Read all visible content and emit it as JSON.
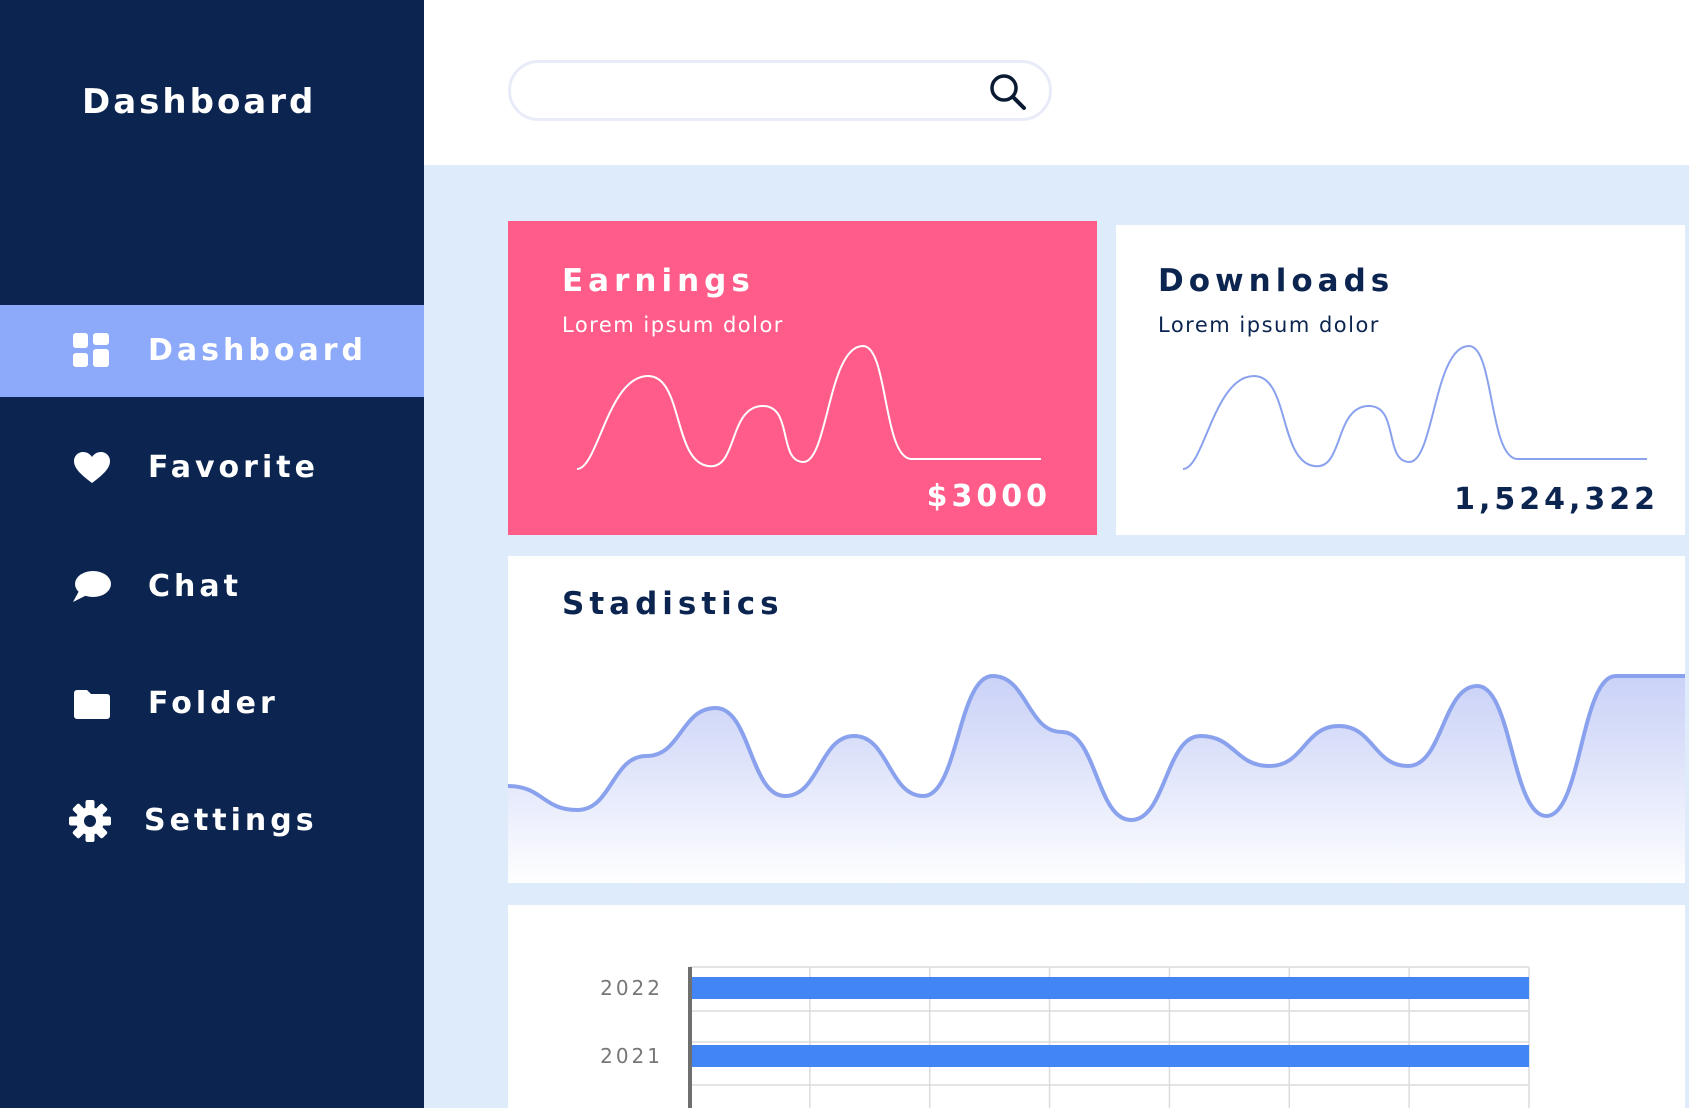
{
  "sidebar": {
    "title": "Dashboard",
    "items": [
      {
        "label": "Dashboard",
        "icon": "grid-icon",
        "active": true
      },
      {
        "label": "Favorite",
        "icon": "heart-icon",
        "active": false
      },
      {
        "label": "Chat",
        "icon": "chat-bubble-icon",
        "active": false
      },
      {
        "label": "Folder",
        "icon": "folder-icon",
        "active": false
      },
      {
        "label": "Settings",
        "icon": "gear-icon",
        "active": false
      }
    ]
  },
  "search": {
    "placeholder": "",
    "icon": "search-icon"
  },
  "cards": {
    "earnings": {
      "title": "Earnings",
      "subtitle": "Lorem ipsum dolor",
      "value": "$3000",
      "color": "#ff5c89"
    },
    "downloads": {
      "title": "Downloads",
      "subtitle": "Lorem ipsum dolor",
      "value": "1,524,322"
    }
  },
  "stats": {
    "title": "Stadistics"
  },
  "colors": {
    "sidebar": "#0b2550",
    "active": "#8ca9fa",
    "accent": "#4285f4",
    "line": "#8aa2ee",
    "background": "#ddebfb"
  },
  "chart_data": [
    {
      "type": "line",
      "title": "Stadistics",
      "x": [
        0,
        1,
        2,
        3,
        4,
        5,
        6,
        7,
        8,
        9,
        10,
        11,
        12,
        13,
        14,
        15,
        16,
        17
      ],
      "series": [
        {
          "values": [
            0.35,
            0.23,
            0.5,
            0.74,
            0.3,
            0.6,
            0.3,
            0.9,
            0.62,
            0.18,
            0.6,
            0.45,
            0.65,
            0.45,
            0.85,
            0.2,
            0.9,
            0.9
          ]
        }
      ],
      "ylim": [
        0,
        1
      ],
      "fill": "area-gradient",
      "grid": false
    },
    {
      "type": "bar",
      "orientation": "horizontal",
      "categories": [
        "2022",
        "2021"
      ],
      "values": [
        7,
        7
      ],
      "xlim": [
        0,
        7
      ],
      "grid": true
    }
  ]
}
